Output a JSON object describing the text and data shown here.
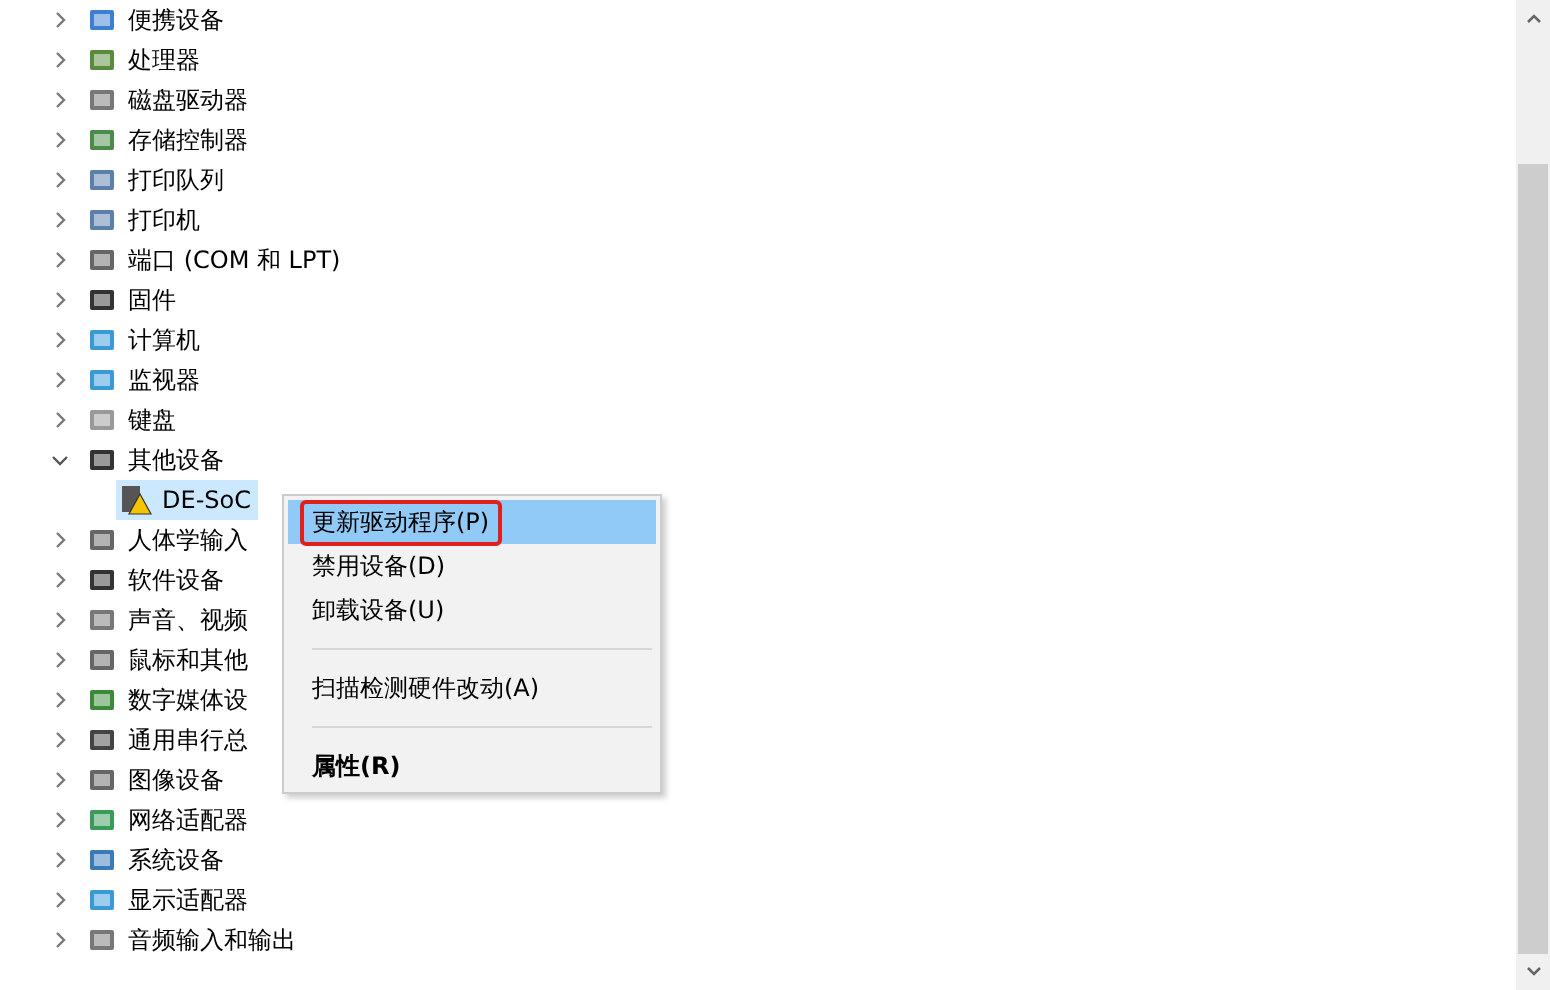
{
  "tree": [
    {
      "label": "便携设备",
      "expanded": false
    },
    {
      "label": "处理器",
      "expanded": false
    },
    {
      "label": "磁盘驱动器",
      "expanded": false
    },
    {
      "label": "存储控制器",
      "expanded": false
    },
    {
      "label": "打印队列",
      "expanded": false
    },
    {
      "label": "打印机",
      "expanded": false
    },
    {
      "label": "端口 (COM 和 LPT)",
      "expanded": false
    },
    {
      "label": "固件",
      "expanded": false
    },
    {
      "label": "计算机",
      "expanded": false
    },
    {
      "label": "监视器",
      "expanded": false
    },
    {
      "label": "键盘",
      "expanded": false
    },
    {
      "label": "其他设备",
      "expanded": true,
      "children": [
        {
          "label": "DE-SoC",
          "selected": true,
          "warning": true
        }
      ]
    },
    {
      "label": "人体学输入",
      "expanded": false
    },
    {
      "label": "软件设备",
      "expanded": false
    },
    {
      "label": "声音、视频",
      "expanded": false
    },
    {
      "label": "鼠标和其他",
      "expanded": false
    },
    {
      "label": "数字媒体设",
      "expanded": false
    },
    {
      "label": "通用串行总",
      "expanded": false
    },
    {
      "label": "图像设备",
      "expanded": false
    },
    {
      "label": "网络适配器",
      "expanded": false
    },
    {
      "label": "系统设备",
      "expanded": false
    },
    {
      "label": "显示适配器",
      "expanded": false
    },
    {
      "label": "音频输入和输出",
      "expanded": false
    }
  ],
  "context_menu": {
    "items": [
      {
        "kind": "item",
        "label": "更新驱动程序(P)",
        "selected": true,
        "annotated": true
      },
      {
        "kind": "item",
        "label": "禁用设备(D)",
        "selected": false,
        "annotated": false
      },
      {
        "kind": "item",
        "label": "卸载设备(U)",
        "selected": false,
        "annotated": false
      },
      {
        "kind": "separator"
      },
      {
        "kind": "item",
        "label": "扫描检测硬件改动(A)",
        "selected": false,
        "annotated": false
      },
      {
        "kind": "separator"
      },
      {
        "kind": "default",
        "label": "属性(R)",
        "selected": false,
        "annotated": false
      }
    ]
  }
}
